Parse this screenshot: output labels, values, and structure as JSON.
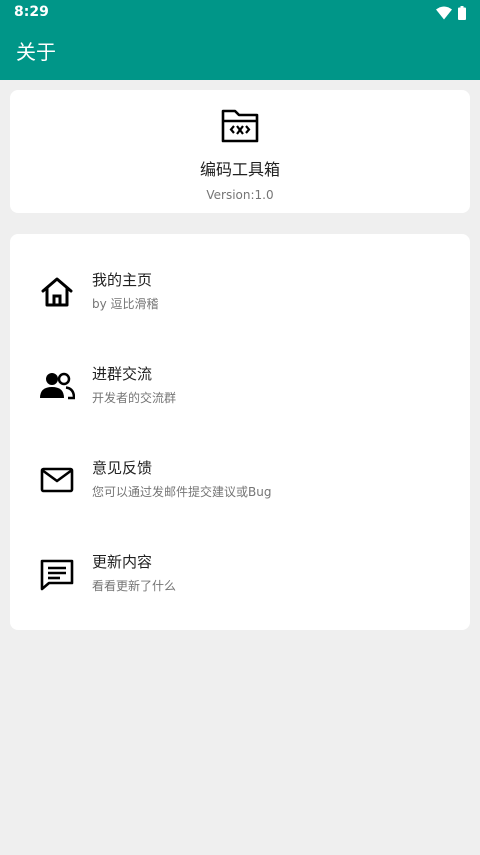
{
  "status_bar": {
    "time": "8:29",
    "icons": [
      "wifi-icon",
      "battery-icon"
    ]
  },
  "app_bar": {
    "title": "关于",
    "background": "#009688"
  },
  "app_info": {
    "icon": "folder-code-icon",
    "name": "编码工具箱",
    "version": "Version:1.0"
  },
  "menu": {
    "items": [
      {
        "icon": "home-icon",
        "title": "我的主页",
        "subtitle": "by 逗比滑稽"
      },
      {
        "icon": "group-icon",
        "title": "进群交流",
        "subtitle": "开发者的交流群"
      },
      {
        "icon": "mail-icon",
        "title": "意见反馈",
        "subtitle": "您可以通过发邮件提交建议或Bug"
      },
      {
        "icon": "message-icon",
        "title": "更新内容",
        "subtitle": "看看更新了什么"
      }
    ]
  }
}
